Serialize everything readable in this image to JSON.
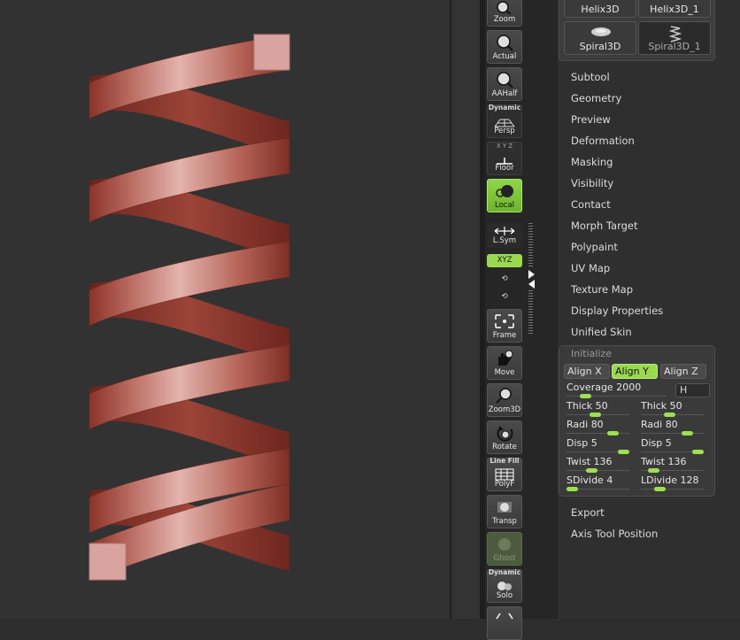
{
  "tool_palette": {
    "thumbnails": [
      {
        "label": "Helix3D",
        "selected": false
      },
      {
        "label": "Helix3D_1",
        "selected": false
      },
      {
        "label": "Spiral3D",
        "selected": false
      },
      {
        "label": "Spiral3D_1",
        "selected": true
      }
    ],
    "menu_top": [
      "Subtool",
      "Geometry",
      "Preview",
      "Deformation",
      "Masking",
      "Visibility",
      "Contact",
      "Morph Target",
      "Polypaint",
      "UV Map",
      "Texture Map",
      "Display Properties",
      "Unified Skin"
    ],
    "initialize": {
      "title": "Initialize",
      "align_x": "Align X",
      "align_y": "Align Y",
      "align_z": "Align Z",
      "coverage_label": "Coverage",
      "coverage_value": "2000",
      "coverage_fraction": 0.15,
      "h_button": "H",
      "sliders": [
        {
          "label": "Thick",
          "value": "50",
          "fraction": 0.45
        },
        {
          "label": "Thick",
          "value": "50",
          "fraction": 0.45
        },
        {
          "label": "Radi",
          "value": "80",
          "fraction": 0.8
        },
        {
          "label": "Radi",
          "value": "80",
          "fraction": 0.8
        },
        {
          "label": "Disp",
          "value": "5",
          "fraction": 1.0
        },
        {
          "label": "Disp",
          "value": "5",
          "fraction": 1.0
        },
        {
          "label": "Twist",
          "value": "136",
          "fraction": 0.38
        },
        {
          "label": "Twist",
          "value": "136",
          "fraction": 0.14
        },
        {
          "label": "SDivide",
          "value": "4",
          "fraction": 0.0
        },
        {
          "label": "LDivide",
          "value": "128",
          "fraction": 0.25
        }
      ]
    },
    "menu_bottom": [
      "Export",
      "Axis Tool Position"
    ]
  },
  "shelf": {
    "zoom": "Zoom",
    "actual": "Actual",
    "aahalf": "AAHalf",
    "persp_sup": "Dynamic",
    "persp": "Persp",
    "floor": "Floor",
    "floor_axes": "X Y Z",
    "local": "Local",
    "lsym": "L.Sym",
    "xyz": "XYZ",
    "frame": "Frame",
    "move": "Move",
    "zoom3d": "Zoom3D",
    "rotate": "Rotate",
    "polyf_sup": "Line Fill",
    "polyf": "PolyF",
    "transp": "Transp",
    "ghost": "Ghost",
    "solo_sup": "Dynamic",
    "solo": "Solo"
  },
  "colors": {
    "accent": "#9ad94f",
    "model": "#a84a3e",
    "model_light": "#d9a8a2"
  }
}
